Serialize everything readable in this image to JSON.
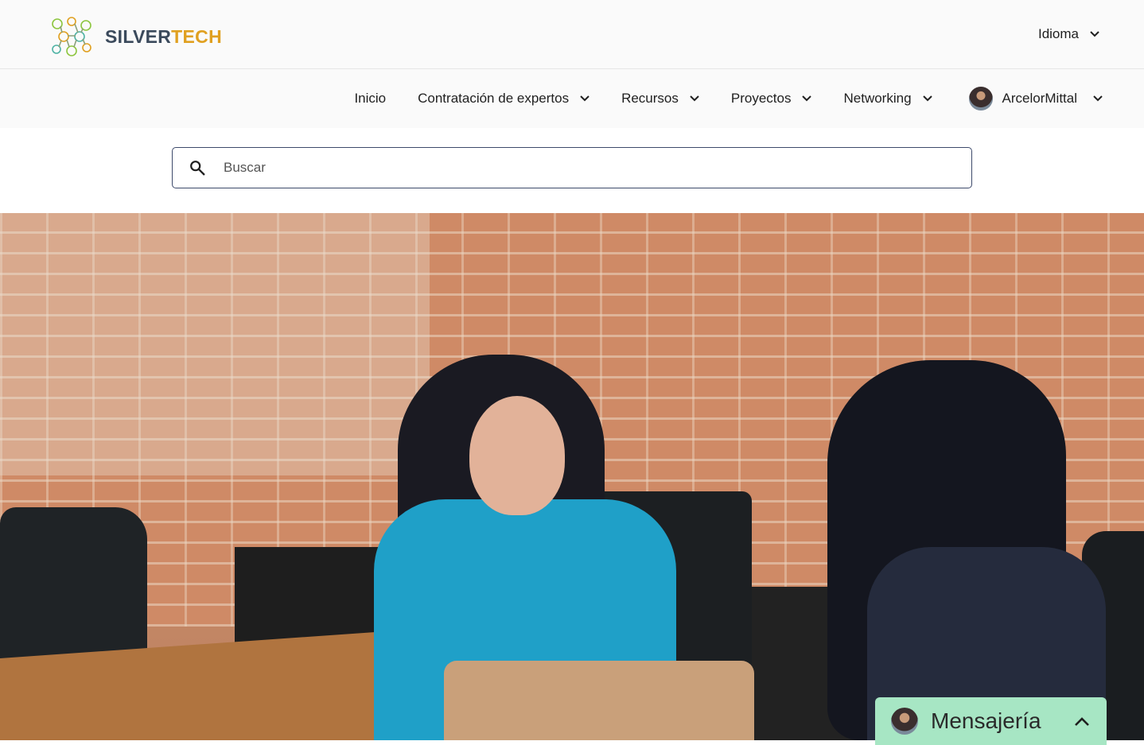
{
  "brand": {
    "name_part1": "SILVER",
    "name_part2": "TECH",
    "logo_icon": "network-people-icon",
    "colors": {
      "primary": "#3b4a5c",
      "accent": "#e0a020",
      "logo_green": "#8dc63f"
    }
  },
  "header": {
    "language_label": "Idioma"
  },
  "nav": {
    "items": [
      {
        "label": "Inicio",
        "has_dropdown": false
      },
      {
        "label": "Contratación de expertos",
        "has_dropdown": true
      },
      {
        "label": "Recursos",
        "has_dropdown": true
      },
      {
        "label": "Proyectos",
        "has_dropdown": true
      },
      {
        "label": "Networking",
        "has_dropdown": true
      }
    ],
    "user": {
      "name": "ArcelorMittal",
      "has_dropdown": true
    }
  },
  "search": {
    "placeholder": "Buscar",
    "value": ""
  },
  "hero": {
    "image_semantic": "two-women-meeting-photo"
  },
  "messaging": {
    "label": "Mensajería",
    "color": "#a7e6c4",
    "toggle_icon": "chevron-up-icon"
  }
}
